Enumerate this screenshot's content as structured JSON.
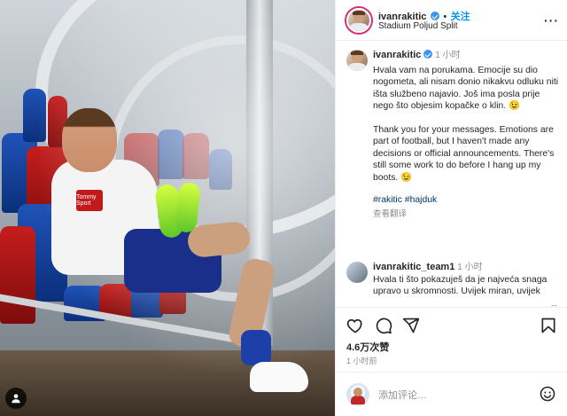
{
  "post": {
    "username": "ivanrakitic",
    "follow_sep": "•",
    "follow_label": "关注",
    "location": "Stadium Poljud Split",
    "more_label": "···"
  },
  "photo": {
    "sponsor_text": "Tommy Sport"
  },
  "caption": {
    "username": "ivanrakitic",
    "time": "1 小时",
    "text_hr": "Hvala vam na porukama. Emocije su dio nogometa, ali nisam donio nikakvu odluku niti išta službeno najavio. Još ima posla prije nego što objesim kopačke o klin. 😉",
    "text_en": "Thank you for your messages. Emotions are part of football, but I haven't made any decisions or official announcements. There's still some work to do before I hang up my boots. 😉",
    "tags": "#rakitic #hajduk",
    "translate": "查看翻译"
  },
  "comment": {
    "username": "ivanrakitic_team1",
    "time": "1 小时",
    "text": "Hvala ti što pokazuješ da je najveća snaga upravo u skromnosti. Uvijek miran, uvijek"
  },
  "actions": {
    "likes": "4.6万次赞",
    "ago": "1 小时前",
    "icons": [
      "heart-icon",
      "comment-icon",
      "share-icon",
      "bookmark-icon"
    ]
  },
  "comment_box": {
    "placeholder": "添加评论…"
  },
  "colors": {
    "accent": "#0095f6",
    "hashtag": "#00376b",
    "muted": "#8e8e8e",
    "verified": "#3897f0"
  }
}
